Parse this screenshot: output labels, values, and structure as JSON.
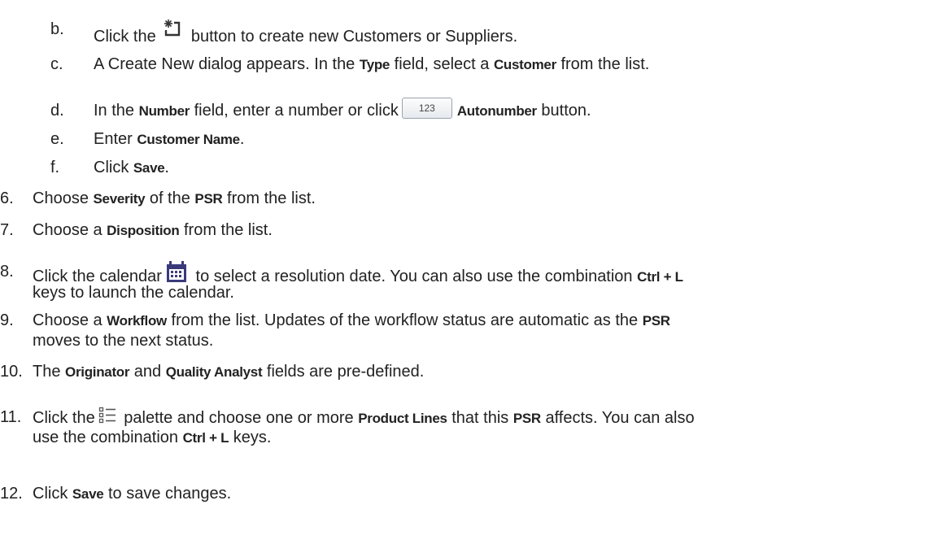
{
  "steps": [
    {
      "marker": "b.",
      "before": "Click the",
      "after": "button to create new Customers or Suppliers."
    },
    {
      "marker": "c.",
      "t1": "A Create New dialog appears. In the ",
      "b1": "Type",
      "t2": " field, select a ",
      "b2": "Customer",
      "t3": " from the list."
    },
    {
      "marker": "d.",
      "t1": "In the ",
      "b1": "Number",
      "t2": " field, enter a number or click",
      "button_label": "123",
      "b2": "Autonumber",
      "t3": " button."
    },
    {
      "marker": "e.",
      "t1": "Enter ",
      "b1": "Customer Name",
      "t2": "."
    },
    {
      "marker": "f.",
      "t1": "Click ",
      "b1": "Save",
      "t2": "."
    },
    {
      "marker": "6.",
      "t1": "Choose ",
      "b1": "Severity",
      "t2": " of the ",
      "b2": "PSR",
      "t3": " from the list."
    },
    {
      "marker": "7.",
      "t1": "Choose a ",
      "b1": "Disposition",
      "t2": " from the list."
    },
    {
      "marker": "8.",
      "t1": "Click the calendar",
      "t2": " to select a resolution date. You can also use the combination ",
      "b1": "Ctrl + L",
      "t3": "keys to launch the calendar."
    },
    {
      "marker": "9.",
      "t1": "Choose a ",
      "b1": "Workflow",
      "t2": " from the list. Updates of the workflow status are automatic as the ",
      "b2": "PSR",
      "t3": "moves to the next status."
    },
    {
      "marker": "10.",
      "t1": "The ",
      "b1": "Originator",
      "t2": " and ",
      "b2": "Quality Analyst",
      "t3": " fields are pre-defined."
    },
    {
      "marker": "11.",
      "t1": "Click the",
      "t2": " palette and choose one or more ",
      "b1": "Product Lines",
      "t3": " that this ",
      "b2": "PSR",
      "t4": " affects. You can also",
      "t5": "use the combination ",
      "b3": "Ctrl + L",
      "t6": " keys."
    },
    {
      "marker": "12.",
      "t1": "Click ",
      "b1": "Save",
      "t2": " to save changes."
    }
  ],
  "icons": {
    "new": "new-record-icon",
    "calendar": "calendar-icon",
    "palette": "list-palette-icon"
  },
  "colors": {
    "text": "#222222",
    "calendar_icon": "#3a3a7a"
  }
}
